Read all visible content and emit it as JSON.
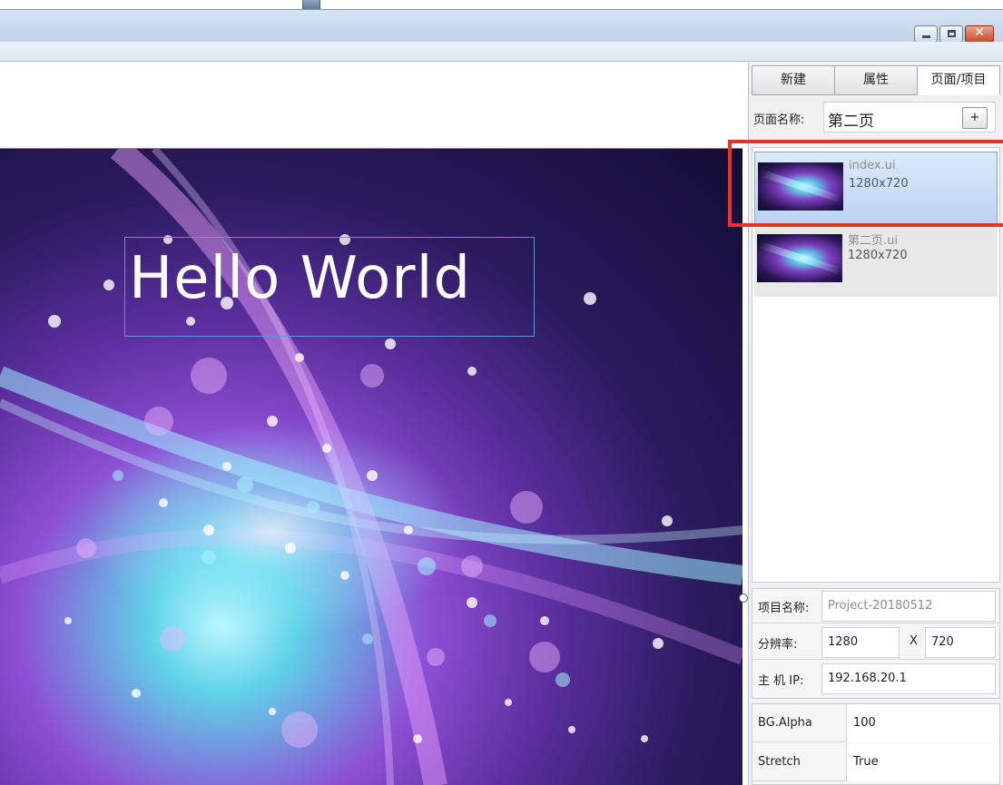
{
  "window": {
    "buttons": {
      "minimize": "minimize-icon",
      "maximize": "maximize-icon",
      "close": "✕"
    }
  },
  "stage": {
    "heading": "Hello World"
  },
  "panel": {
    "tabs": [
      {
        "label": "新建",
        "active": false
      },
      {
        "label": "属性",
        "active": false
      },
      {
        "label": "页面/项目",
        "active": true
      }
    ],
    "page_name_label": "页面名称:",
    "page_name_value": "第二页",
    "add_label": "+",
    "pages": [
      {
        "name": "index.ui",
        "resolution": "1280x720",
        "selected": true
      },
      {
        "name": "第二页.ui",
        "resolution": "1280x720",
        "selected": false
      }
    ],
    "project": {
      "name_label": "项目名称:",
      "name_value": "Project-20180512",
      "res_label": "分辨率:",
      "res_width": "1280",
      "res_x": "X",
      "res_height": "720",
      "host_label": "主 机  IP:",
      "host_value": "192.168.20.1"
    },
    "properties": [
      {
        "key": "BG.Alpha",
        "value": "100"
      },
      {
        "key": "Stretch",
        "value": "True"
      }
    ]
  },
  "colors": {
    "highlight": "#e8322e",
    "accent": "#7da2ce"
  }
}
